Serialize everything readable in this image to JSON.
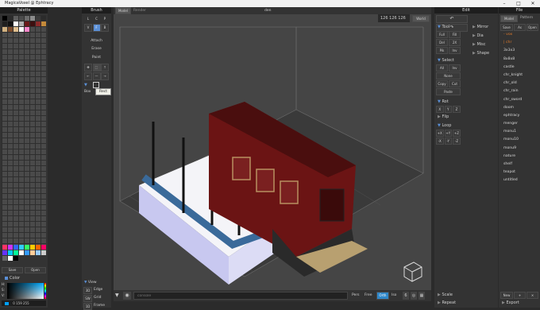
{
  "window": {
    "title": "MagicaVoxel @ Ephtracy"
  },
  "palette": {
    "title": "Palette",
    "top_colors": [
      "#000000",
      "#2b2b2b",
      "#5c5c5c",
      "#4a4a4a",
      "#6b6b6b",
      "#8c8c8c",
      "#3a3a3a",
      "#2b2b2b",
      "#1f1f1f",
      "#101010",
      "#ffffff",
      "#b0b0b0",
      "#6b1a1a",
      "#3d0f0f",
      "#8a2a2a",
      "#c48a3a",
      "#d0b080",
      "#7a4a2a",
      "#e0c090",
      "#ffffff",
      "#ff88cc"
    ],
    "bottom_colors": [
      "#ff3366",
      "#cc33ff",
      "#3366ff",
      "#33ccff",
      "#33ff66",
      "#ffcc00",
      "#ff6600",
      "#ff0066",
      "#6633ff",
      "#00ccff",
      "#00ff99",
      "#ffffff",
      "#3399ff",
      "#ffcc99",
      "#99ccff",
      "#cccccc",
      "#666666",
      "#ffffff",
      "#000000"
    ],
    "save_label": "Save",
    "open_label": "Open"
  },
  "color": {
    "title": "Color",
    "h_label": "H:",
    "s_label": "S:",
    "v_label": "V:",
    "rgb_value": "0 159 255"
  },
  "brush": {
    "title": "Brush",
    "modes_row1": [
      "L",
      "C",
      "P"
    ],
    "modes_row2": [
      "V",
      "F",
      "B"
    ],
    "actions": [
      "Attach",
      "Erase",
      "Paint"
    ],
    "tooltip": "Rect",
    "box_label": "Box"
  },
  "view": {
    "title": "View",
    "rows": [
      [
        "3D",
        "Edge"
      ],
      [
        "SW",
        "Grid"
      ],
      [
        "1D",
        "Frame"
      ]
    ]
  },
  "tabs": {
    "model": "Model",
    "render": "Render",
    "pattern": "Pattern"
  },
  "viewport": {
    "scene_name": "den",
    "size": [
      "126",
      "126",
      "126"
    ],
    "world_label": "World",
    "console_placeholder": "console",
    "bottom_modes": [
      "Pers",
      "Free",
      "Orth",
      "Iso"
    ],
    "accent": "#2f87c9"
  },
  "edit": {
    "title": "Edit",
    "tool_label": "Tool",
    "tool_buttons": [
      "Full",
      "Fill",
      "Del",
      "2X",
      "Pik",
      "Inv"
    ],
    "select_label": "Select",
    "select_buttons": [
      "All",
      "Inv",
      "None",
      "Copy",
      "Cut",
      "Paste"
    ],
    "rot_label": "Rot",
    "rot_buttons": [
      "X",
      "Y",
      "Z"
    ],
    "flip_label": "Flip",
    "loop_label": "Loop",
    "loop_buttons": [
      "+X",
      "+Y",
      "+Z",
      "-X",
      "-Y",
      "-Z"
    ],
    "scale_label": "Scale",
    "repeat_label": "Repeat",
    "side_items": [
      "Mirror",
      "Dia",
      "Misc",
      "Shape"
    ]
  },
  "file": {
    "title": "File",
    "actions": [
      "Save",
      "As",
      "Open"
    ],
    "items": [
      "vox",
      "chr",
      "3x3x3",
      "8x8x8",
      "castle",
      "chr_knight",
      "chr_old",
      "chr_rain",
      "chr_sword",
      "doom",
      "ephtracy",
      "menger",
      "monu1",
      "monu10",
      "monu9",
      "nature",
      "shelf",
      "teapot",
      "untitled"
    ],
    "new_label": "New",
    "export_label": "Export"
  }
}
